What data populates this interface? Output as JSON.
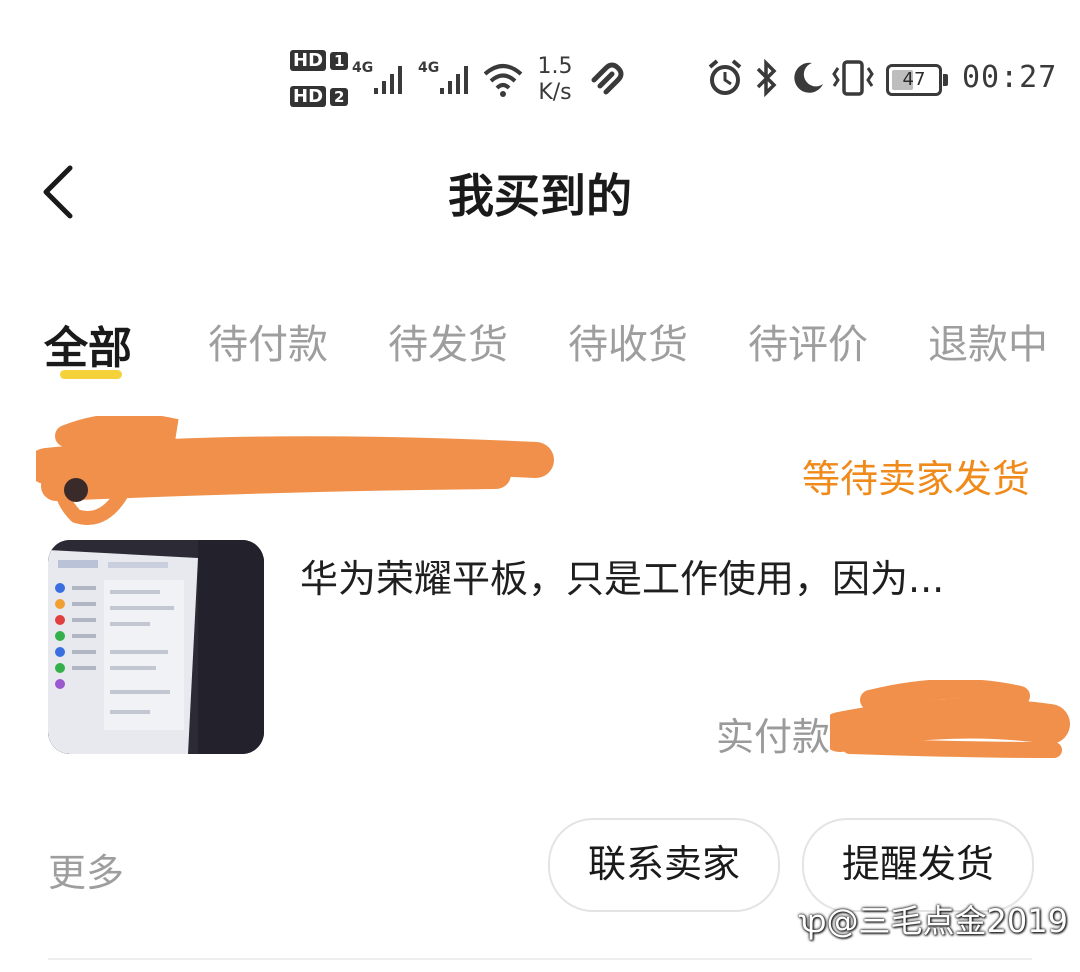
{
  "status_bar": {
    "sim1": "HD",
    "sim1_num": "1",
    "sim2": "HD",
    "sim2_num": "2",
    "net1": "4G",
    "net2": "4G",
    "speed_value": "1.5",
    "speed_unit": "K/s",
    "battery": "47",
    "battery_level": 0.47,
    "time": "00:27",
    "icons": [
      "wifi-icon",
      "alarm-icon",
      "bluetooth-icon",
      "moon-icon",
      "vibrate-icon"
    ]
  },
  "header": {
    "title": "我买到的"
  },
  "tabs": [
    {
      "label": "全部",
      "active": true
    },
    {
      "label": "待付款",
      "active": false
    },
    {
      "label": "待发货",
      "active": false
    },
    {
      "label": "待收货",
      "active": false
    },
    {
      "label": "待评价",
      "active": false
    },
    {
      "label": "退款中",
      "active": false
    }
  ],
  "order": {
    "status": "等待卖家发货",
    "product_title": "华为荣耀平板，只是工作使用，因为...",
    "paid_label": "实付款"
  },
  "actions": {
    "more": "更多",
    "contact": "联系卖家",
    "remind": "提醒发货"
  },
  "watermark": "@三毛点金2019",
  "colors": {
    "accent_yellow": "#f6d23a",
    "status_orange": "#f08a1b",
    "redaction": "#f0904a"
  }
}
